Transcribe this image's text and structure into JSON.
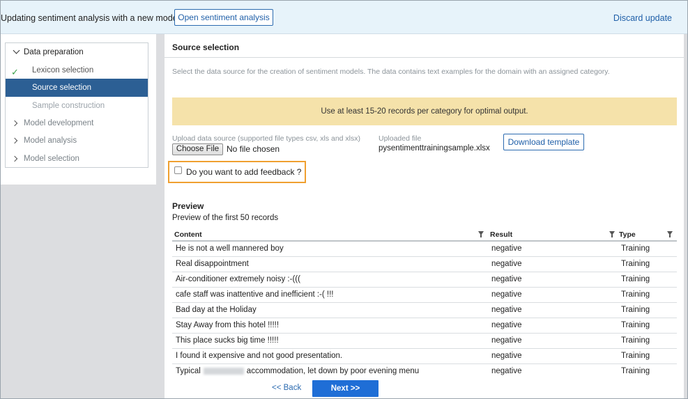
{
  "header": {
    "title": "Updating sentiment analysis with a new model",
    "open_button": "Open sentiment analysis",
    "discard_link": "Discard update"
  },
  "steps": {
    "data_preparation": "Data preparation",
    "lexicon_selection": "Lexicon selection",
    "source_selection": "Source selection",
    "sample_construction": "Sample construction",
    "model_development": "Model development",
    "model_analysis": "Model analysis",
    "model_selection": "Model selection"
  },
  "main": {
    "section_title": "Source selection",
    "description": "Select the data source for the creation of sentiment models. The data contains text examples for the domain with an assigned category.",
    "banner": "Use at least 15-20 records per category for optimal output.",
    "upload_label": "Upload data source (supported file types csv, xls and xlsx)",
    "choose_file": "Choose File",
    "no_file": "No file chosen",
    "uploaded_label": "Uploaded file",
    "uploaded_file": "pysentimenttrainingsample.xlsx",
    "download_template": "Download template",
    "feedback_question": "Do you want to add feedback ?",
    "preview_title": "Preview",
    "preview_subtitle": "Preview of the first 50 records"
  },
  "table": {
    "headers": {
      "content": "Content",
      "result": "Result",
      "type": "Type"
    },
    "rows": [
      {
        "content": "He is not a well mannered boy",
        "result": "negative",
        "type": "Training"
      },
      {
        "content": "Real disappointment",
        "result": "negative",
        "type": "Training"
      },
      {
        "content": "Air-conditioner extremely noisy :-(((",
        "result": "negative",
        "type": "Training"
      },
      {
        "content": "cafe staff was inattentive and inefficient :-( !!!",
        "result": "negative",
        "type": "Training"
      },
      {
        "content": "Bad day at the Holiday",
        "result": "negative",
        "type": "Training"
      },
      {
        "content": "Stay Away from this hotel !!!!!",
        "result": "negative",
        "type": "Training"
      },
      {
        "content": "This place sucks big time !!!!!",
        "result": "negative",
        "type": "Training"
      },
      {
        "content": "I found it expensive and not good presentation.",
        "result": "negative",
        "type": "Training"
      },
      {
        "content_start": "Typical",
        "content_end": "accommodation, let down by poor evening menu",
        "result": "negative",
        "type": "Training"
      }
    ]
  },
  "footer": {
    "back": "<< Back",
    "next": "Next >>"
  }
}
